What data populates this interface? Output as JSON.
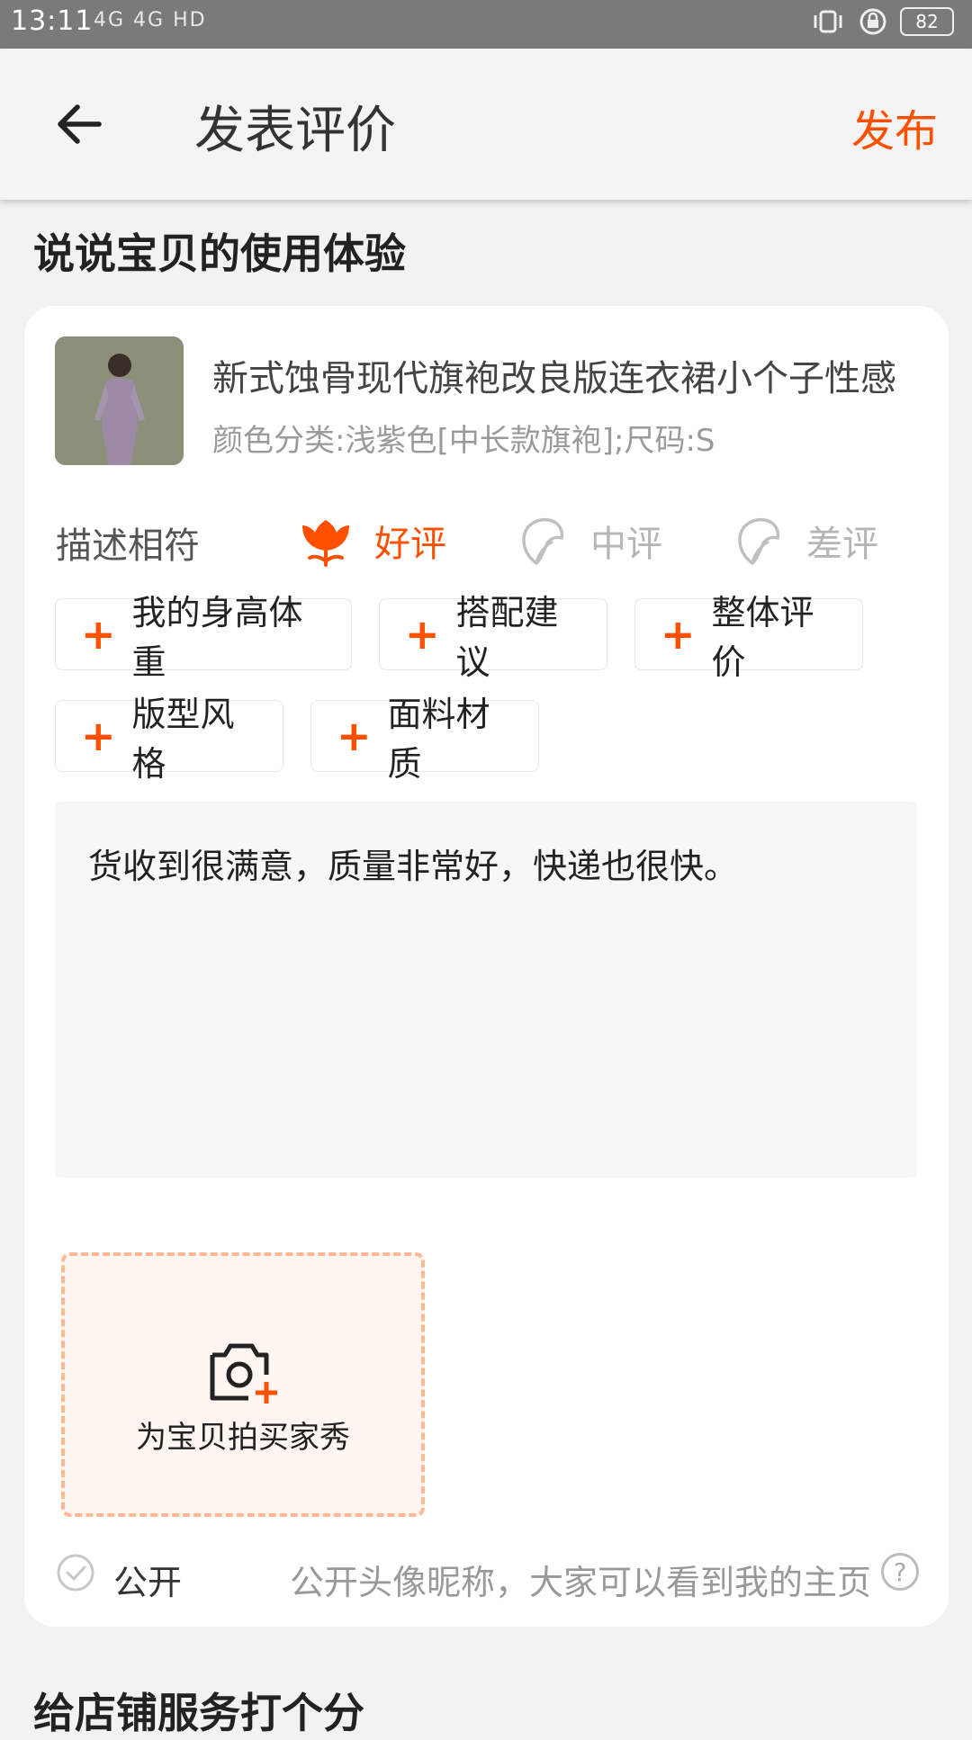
{
  "status_bar": {
    "time": "13:11",
    "signal": "4G 4G HD",
    "battery": "82"
  },
  "app_bar": {
    "title": "发表评价",
    "publish_label": "发布"
  },
  "sections": {
    "experience_title": "说说宝贝的使用体验",
    "shop_service_title": "给店铺服务打个分"
  },
  "product": {
    "title": "新式蚀骨现代旗袍改良版连衣裙小个子性感",
    "sku": "颜色分类:浅紫色[中长款旗袍];尺码:S"
  },
  "rating": {
    "label": "描述相符",
    "options": [
      {
        "label": "好评",
        "selected": true,
        "color": "#ff5000"
      },
      {
        "label": "中评",
        "selected": false,
        "color": "#b5b5b5"
      },
      {
        "label": "差评",
        "selected": false,
        "color": "#b5b5b5"
      }
    ]
  },
  "tags": [
    {
      "label": "我的身高体重"
    },
    {
      "label": "搭配建议"
    },
    {
      "label": "整体评价"
    },
    {
      "label": "版型风格"
    },
    {
      "label": "面料材质"
    }
  ],
  "review": {
    "text": "货收到很满意，质量非常好，快递也很快。"
  },
  "photo": {
    "label": "为宝贝拍买家秀"
  },
  "public": {
    "label": "公开",
    "description": "公开头像昵称，大家可以看到我的主页",
    "help": "?"
  },
  "colors": {
    "accent": "#ff5000",
    "dashed_border": "#ffb894"
  }
}
